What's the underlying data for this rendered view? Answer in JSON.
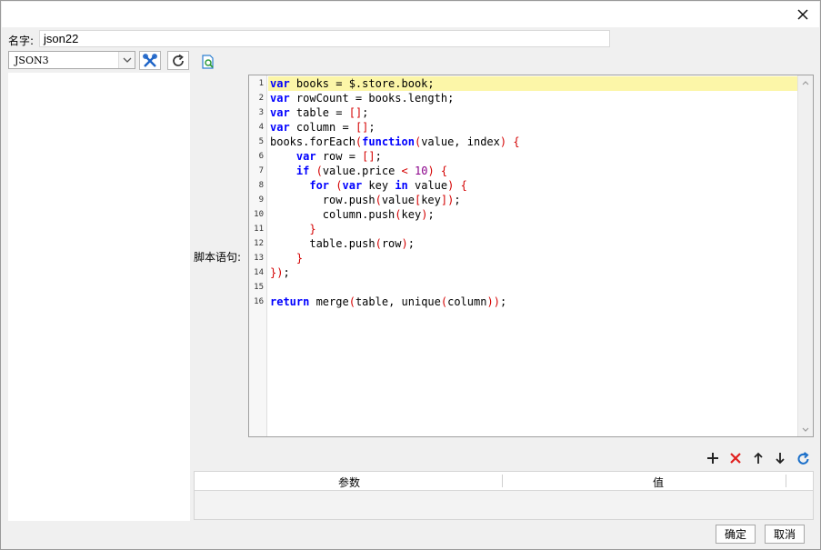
{
  "dialog": {
    "name_label": "名字:",
    "name_value": "json22",
    "datasource_select": "JSON3",
    "script_label": "脚本语句:"
  },
  "editor": {
    "line_numbers": [
      "1",
      "2",
      "3",
      "4",
      "5",
      "6",
      "7",
      "8",
      "9",
      "10",
      "11",
      "12",
      "13",
      "14",
      "15",
      "16"
    ],
    "active_line": 1,
    "lines": [
      [
        {
          "t": "var",
          "c": "kw"
        },
        {
          "t": " books = $.store.book;"
        }
      ],
      [
        {
          "t": "var",
          "c": "kw"
        },
        {
          "t": " rowCount = books.length;"
        }
      ],
      [
        {
          "t": "var",
          "c": "kw"
        },
        {
          "t": " table = "
        },
        {
          "t": "[]",
          "c": "p"
        },
        {
          "t": ";"
        }
      ],
      [
        {
          "t": "var",
          "c": "kw"
        },
        {
          "t": " column = "
        },
        {
          "t": "[]",
          "c": "p"
        },
        {
          "t": ";"
        }
      ],
      [
        {
          "t": "books.forEach"
        },
        {
          "t": "(",
          "c": "p"
        },
        {
          "t": "function",
          "c": "kw"
        },
        {
          "t": "(",
          "c": "p"
        },
        {
          "t": "value, index"
        },
        {
          "t": ")",
          "c": "p"
        },
        {
          "t": " "
        },
        {
          "t": "{",
          "c": "p"
        }
      ],
      [
        {
          "t": "    "
        },
        {
          "t": "var",
          "c": "kw"
        },
        {
          "t": " row = "
        },
        {
          "t": "[]",
          "c": "p"
        },
        {
          "t": ";"
        }
      ],
      [
        {
          "t": "    "
        },
        {
          "t": "if",
          "c": "kw"
        },
        {
          "t": " "
        },
        {
          "t": "(",
          "c": "p"
        },
        {
          "t": "value.price "
        },
        {
          "t": "<",
          "c": "p"
        },
        {
          "t": " "
        },
        {
          "t": "10",
          "c": "n"
        },
        {
          "t": ")",
          "c": "p"
        },
        {
          "t": " "
        },
        {
          "t": "{",
          "c": "p"
        }
      ],
      [
        {
          "t": "      "
        },
        {
          "t": "for",
          "c": "kw"
        },
        {
          "t": " "
        },
        {
          "t": "(",
          "c": "p"
        },
        {
          "t": "var",
          "c": "kw"
        },
        {
          "t": " key "
        },
        {
          "t": "in",
          "c": "kw"
        },
        {
          "t": " value"
        },
        {
          "t": ")",
          "c": "p"
        },
        {
          "t": " "
        },
        {
          "t": "{",
          "c": "p"
        }
      ],
      [
        {
          "t": "        row.push"
        },
        {
          "t": "(",
          "c": "p"
        },
        {
          "t": "value"
        },
        {
          "t": "[",
          "c": "p"
        },
        {
          "t": "key"
        },
        {
          "t": "]",
          "c": "p"
        },
        {
          "t": ")",
          "c": "p"
        },
        {
          "t": ";"
        }
      ],
      [
        {
          "t": "        column.push"
        },
        {
          "t": "(",
          "c": "p"
        },
        {
          "t": "key"
        },
        {
          "t": ")",
          "c": "p"
        },
        {
          "t": ";"
        }
      ],
      [
        {
          "t": "      "
        },
        {
          "t": "}",
          "c": "p"
        }
      ],
      [
        {
          "t": "      table.push"
        },
        {
          "t": "(",
          "c": "p"
        },
        {
          "t": "row"
        },
        {
          "t": ")",
          "c": "p"
        },
        {
          "t": ";"
        }
      ],
      [
        {
          "t": "    "
        },
        {
          "t": "}",
          "c": "p"
        }
      ],
      [
        {
          "t": "}",
          "c": "p"
        },
        {
          "t": ")",
          "c": "p"
        },
        {
          "t": ";"
        }
      ],
      [],
      [
        {
          "t": "return",
          "c": "kw"
        },
        {
          "t": " merge"
        },
        {
          "t": "(",
          "c": "p"
        },
        {
          "t": "table, unique"
        },
        {
          "t": "(",
          "c": "p"
        },
        {
          "t": "column"
        },
        {
          "t": ")",
          "c": "p"
        },
        {
          "t": ")",
          "c": "p"
        },
        {
          "t": ";"
        }
      ]
    ]
  },
  "params_table": {
    "columns": [
      "参数",
      "值"
    ]
  },
  "buttons": {
    "ok": "确定",
    "cancel": "取消"
  },
  "icons": {
    "edit": "wrench-scissors-icon",
    "refresh": "refresh-icon",
    "preview": "preview-icon",
    "add": "plus-icon",
    "delete": "delete-x-icon",
    "up": "arrow-up-icon",
    "down": "arrow-down-icon",
    "reset": "reload-icon"
  },
  "colors": {
    "keyword": "#0000ff",
    "punct": "#d40000",
    "number": "#8a008a",
    "active_line": "#fcf6a8",
    "delete": "#e0201f",
    "reset": "#1a6fc9"
  }
}
